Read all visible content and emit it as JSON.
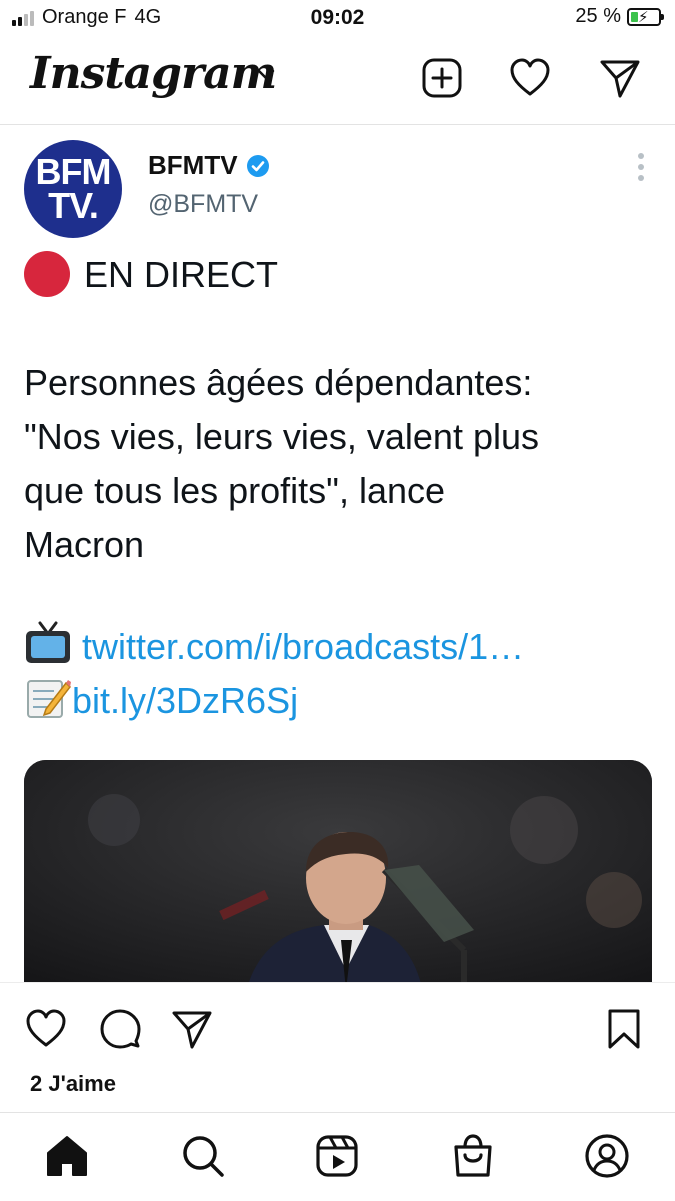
{
  "status_bar": {
    "carrier": "Orange F",
    "network": "4G",
    "time": "09:02",
    "battery": "25 %",
    "battery_level": 0.25
  },
  "header": {
    "logo": "Instagram",
    "icons": [
      "chevron-down-icon",
      "add-post-icon",
      "heart-icon",
      "direct-message-icon"
    ]
  },
  "tweet": {
    "author_name": "BFMTV",
    "author_handle": "@BFMTV",
    "avatar_line1": "BFM",
    "avatar_line2": "TV.",
    "live_label": "EN DIRECT",
    "headline_lines": [
      "Personnes âgées dépendantes:",
      "\"Nos vies, leurs vies, valent plus",
      "que tous les profits\", lance",
      "Macron"
    ],
    "link1": "twitter.com/i/broadcasts/1…",
    "link2": "bit.ly/3DzR6Sj",
    "colors": {
      "link": "#1b95e0",
      "live_dot": "#d7263d",
      "verified": "#1d9bf0",
      "avatar_bg": "#1e2f8d"
    }
  },
  "post_actions": {
    "icons": [
      "heart-icon",
      "comment-icon",
      "share-icon",
      "bookmark-icon"
    ],
    "likes": "2 J'aime"
  },
  "bottom_nav": {
    "icons": [
      "home-icon",
      "search-icon",
      "reels-icon",
      "shop-icon",
      "profile-icon"
    ]
  }
}
